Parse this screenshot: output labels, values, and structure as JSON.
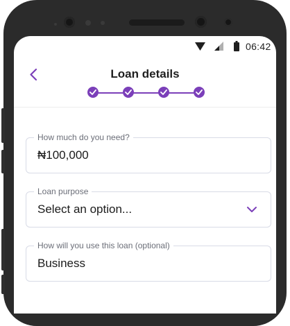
{
  "status_bar": {
    "time": "06:42"
  },
  "header": {
    "title": "Loan details",
    "steps_completed": 4,
    "steps_total": 4
  },
  "form": {
    "amount": {
      "label": "How much do you need?",
      "value": "₦100,000"
    },
    "purpose": {
      "label": "Loan purpose",
      "value": "Select an option..."
    },
    "usage": {
      "label": "How will you use this loan (optional)",
      "value": "Business"
    }
  },
  "colors": {
    "accent": "#7b3fb9",
    "field_border": "#d8dbe6",
    "label": "#6b6e78",
    "bezel": "#2b2b2b"
  },
  "icons": [
    "wifi-icon",
    "signal-icon",
    "battery-icon",
    "back-arrow-icon",
    "check-icon",
    "chevron-down-icon"
  ]
}
